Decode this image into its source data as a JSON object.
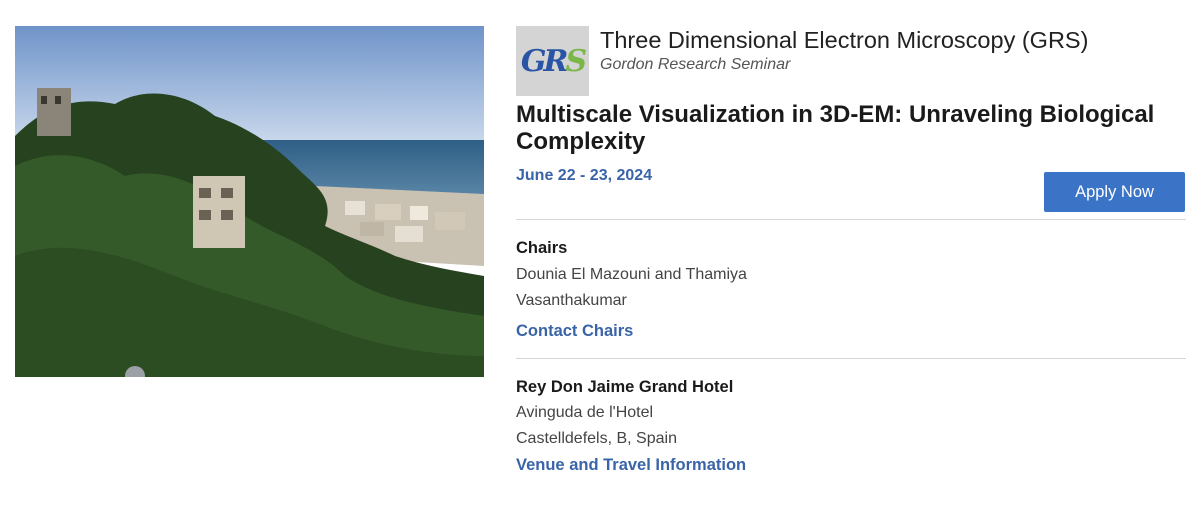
{
  "hero": {
    "image_name": "coastal-hotel-photo"
  },
  "series": {
    "logo_letters": [
      "G",
      "R",
      "S"
    ],
    "title": "Three Dimensional Electron Microscopy (GRS)",
    "subtitle": "Gordon Research Seminar"
  },
  "conference": {
    "title": "Multiscale Visualization in 3D-EM: Unraveling Biological Complexity",
    "dates": "June 22 - 23, 2024",
    "apply_label": "Apply Now"
  },
  "chairs": {
    "heading": "Chairs",
    "line1": "Dounia El Mazouni and Thamiya",
    "line2": "Vasanthakumar",
    "contact_label": "Contact Chairs"
  },
  "venue": {
    "name": "Rey Don Jaime Grand Hotel",
    "address1": "Avinguda de l'Hotel",
    "address2": "Castelldefels, B, Spain",
    "travel_label": "Venue and Travel Information"
  },
  "colors": {
    "accent_blue": "#3a64a8",
    "button_blue": "#3b74c6",
    "logo_green": "#7ab648",
    "logo_bg": "#d4d4d4"
  }
}
